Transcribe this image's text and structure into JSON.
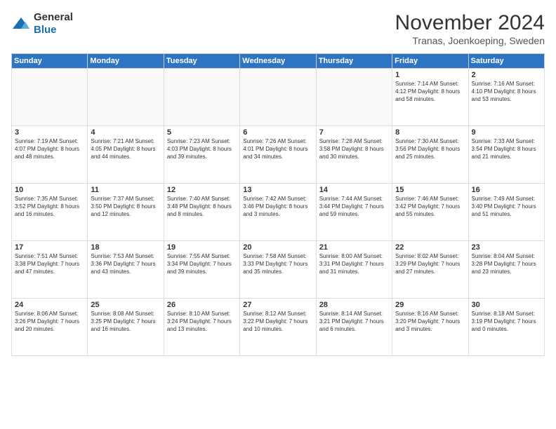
{
  "logo": {
    "general": "General",
    "blue": "Blue"
  },
  "title": "November 2024",
  "location": "Tranas, Joenkoeping, Sweden",
  "days_of_week": [
    "Sunday",
    "Monday",
    "Tuesday",
    "Wednesday",
    "Thursday",
    "Friday",
    "Saturday"
  ],
  "weeks": [
    [
      {
        "day": "",
        "info": ""
      },
      {
        "day": "",
        "info": ""
      },
      {
        "day": "",
        "info": ""
      },
      {
        "day": "",
        "info": ""
      },
      {
        "day": "",
        "info": ""
      },
      {
        "day": "1",
        "info": "Sunrise: 7:14 AM\nSunset: 4:12 PM\nDaylight: 8 hours\nand 58 minutes."
      },
      {
        "day": "2",
        "info": "Sunrise: 7:16 AM\nSunset: 4:10 PM\nDaylight: 8 hours\nand 53 minutes."
      }
    ],
    [
      {
        "day": "3",
        "info": "Sunrise: 7:19 AM\nSunset: 4:07 PM\nDaylight: 8 hours\nand 48 minutes."
      },
      {
        "day": "4",
        "info": "Sunrise: 7:21 AM\nSunset: 4:05 PM\nDaylight: 8 hours\nand 44 minutes."
      },
      {
        "day": "5",
        "info": "Sunrise: 7:23 AM\nSunset: 4:03 PM\nDaylight: 8 hours\nand 39 minutes."
      },
      {
        "day": "6",
        "info": "Sunrise: 7:26 AM\nSunset: 4:01 PM\nDaylight: 8 hours\nand 34 minutes."
      },
      {
        "day": "7",
        "info": "Sunrise: 7:28 AM\nSunset: 3:58 PM\nDaylight: 8 hours\nand 30 minutes."
      },
      {
        "day": "8",
        "info": "Sunrise: 7:30 AM\nSunset: 3:56 PM\nDaylight: 8 hours\nand 25 minutes."
      },
      {
        "day": "9",
        "info": "Sunrise: 7:33 AM\nSunset: 3:54 PM\nDaylight: 8 hours\nand 21 minutes."
      }
    ],
    [
      {
        "day": "10",
        "info": "Sunrise: 7:35 AM\nSunset: 3:52 PM\nDaylight: 8 hours\nand 16 minutes."
      },
      {
        "day": "11",
        "info": "Sunrise: 7:37 AM\nSunset: 3:50 PM\nDaylight: 8 hours\nand 12 minutes."
      },
      {
        "day": "12",
        "info": "Sunrise: 7:40 AM\nSunset: 3:48 PM\nDaylight: 8 hours\nand 8 minutes."
      },
      {
        "day": "13",
        "info": "Sunrise: 7:42 AM\nSunset: 3:46 PM\nDaylight: 8 hours\nand 3 minutes."
      },
      {
        "day": "14",
        "info": "Sunrise: 7:44 AM\nSunset: 3:44 PM\nDaylight: 7 hours\nand 59 minutes."
      },
      {
        "day": "15",
        "info": "Sunrise: 7:46 AM\nSunset: 3:42 PM\nDaylight: 7 hours\nand 55 minutes."
      },
      {
        "day": "16",
        "info": "Sunrise: 7:49 AM\nSunset: 3:40 PM\nDaylight: 7 hours\nand 51 minutes."
      }
    ],
    [
      {
        "day": "17",
        "info": "Sunrise: 7:51 AM\nSunset: 3:38 PM\nDaylight: 7 hours\nand 47 minutes."
      },
      {
        "day": "18",
        "info": "Sunrise: 7:53 AM\nSunset: 3:36 PM\nDaylight: 7 hours\nand 43 minutes."
      },
      {
        "day": "19",
        "info": "Sunrise: 7:55 AM\nSunset: 3:34 PM\nDaylight: 7 hours\nand 39 minutes."
      },
      {
        "day": "20",
        "info": "Sunrise: 7:58 AM\nSunset: 3:33 PM\nDaylight: 7 hours\nand 35 minutes."
      },
      {
        "day": "21",
        "info": "Sunrise: 8:00 AM\nSunset: 3:31 PM\nDaylight: 7 hours\nand 31 minutes."
      },
      {
        "day": "22",
        "info": "Sunrise: 8:02 AM\nSunset: 3:29 PM\nDaylight: 7 hours\nand 27 minutes."
      },
      {
        "day": "23",
        "info": "Sunrise: 8:04 AM\nSunset: 3:28 PM\nDaylight: 7 hours\nand 23 minutes."
      }
    ],
    [
      {
        "day": "24",
        "info": "Sunrise: 8:06 AM\nSunset: 3:26 PM\nDaylight: 7 hours\nand 20 minutes."
      },
      {
        "day": "25",
        "info": "Sunrise: 8:08 AM\nSunset: 3:25 PM\nDaylight: 7 hours\nand 16 minutes."
      },
      {
        "day": "26",
        "info": "Sunrise: 8:10 AM\nSunset: 3:24 PM\nDaylight: 7 hours\nand 13 minutes."
      },
      {
        "day": "27",
        "info": "Sunrise: 8:12 AM\nSunset: 3:22 PM\nDaylight: 7 hours\nand 10 minutes."
      },
      {
        "day": "28",
        "info": "Sunrise: 8:14 AM\nSunset: 3:21 PM\nDaylight: 7 hours\nand 6 minutes."
      },
      {
        "day": "29",
        "info": "Sunrise: 8:16 AM\nSunset: 3:20 PM\nDaylight: 7 hours\nand 3 minutes."
      },
      {
        "day": "30",
        "info": "Sunrise: 8:18 AM\nSunset: 3:19 PM\nDaylight: 7 hours\nand 0 minutes."
      }
    ]
  ]
}
